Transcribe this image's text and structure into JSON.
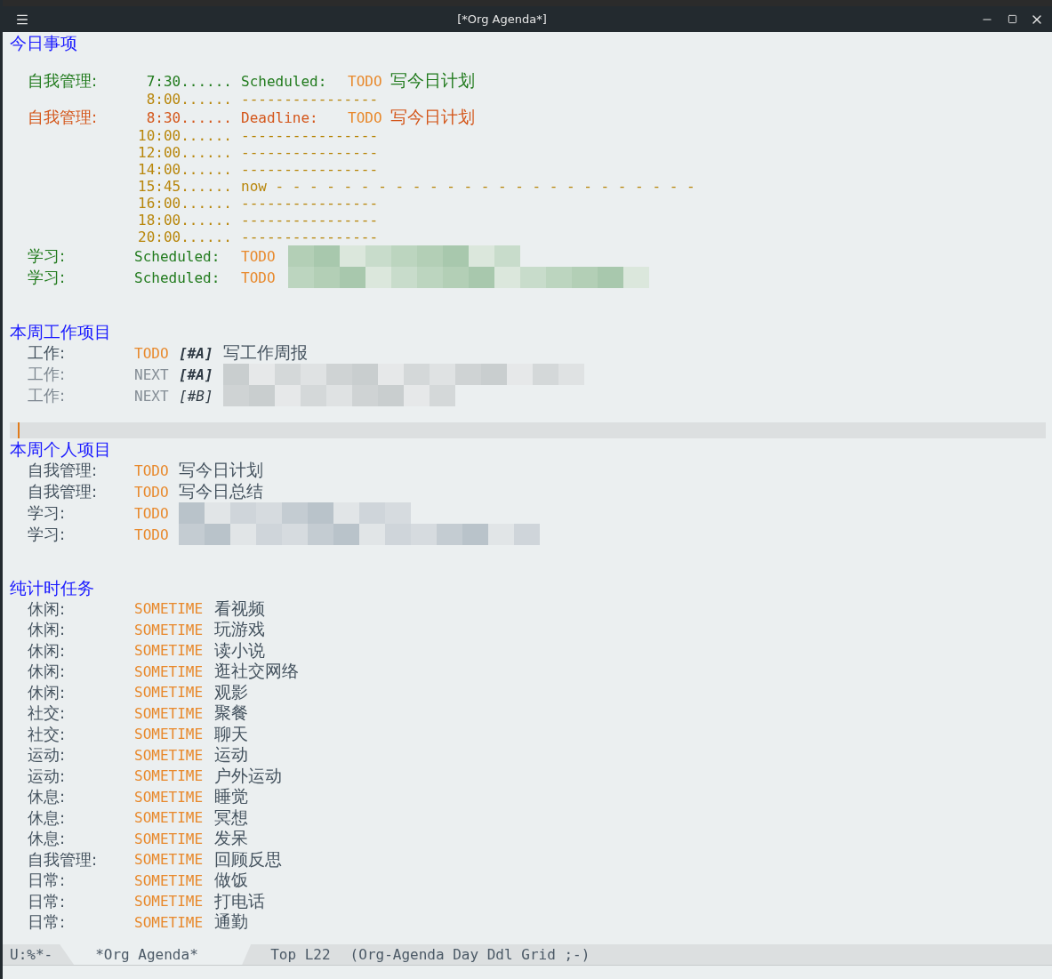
{
  "window": {
    "title": "[*Org Agenda*]"
  },
  "sections": [
    {
      "title": "今日事项",
      "kind": "day",
      "cursor_line": false,
      "items": [
        {
          "kind": "scheduled-timed",
          "category": "自我管理:",
          "time": "7:30......",
          "label": "Scheduled:",
          "keyword": "TODO",
          "text": "写今日计划"
        },
        {
          "kind": "grid",
          "time": "8:00......",
          "line": "----------------"
        },
        {
          "kind": "deadline-timed",
          "category": "自我管理:",
          "time": "8:30......",
          "label": "Deadline:",
          "keyword": "TODO",
          "text": "写今日计划"
        },
        {
          "kind": "grid",
          "time": "10:00......",
          "line": "----------------"
        },
        {
          "kind": "grid",
          "time": "12:00......",
          "line": "----------------"
        },
        {
          "kind": "grid",
          "time": "14:00......",
          "line": "----------------"
        },
        {
          "kind": "now",
          "time": "15:45......",
          "line": "now - - - - - - - - - - - - - - - - - - - - - - - - -"
        },
        {
          "kind": "grid",
          "time": "16:00......",
          "line": "----------------"
        },
        {
          "kind": "grid",
          "time": "18:00......",
          "line": "----------------"
        },
        {
          "kind": "grid",
          "time": "20:00......",
          "line": "----------------"
        },
        {
          "kind": "scheduled",
          "category": "学习:",
          "label": "Scheduled:",
          "keyword": "TODO",
          "redacted": true
        },
        {
          "kind": "scheduled",
          "category": "学习:",
          "label": "Scheduled:",
          "keyword": "TODO",
          "redacted": true
        }
      ]
    },
    {
      "title": "本周工作项目",
      "kind": "list",
      "cursor_line": true,
      "items": [
        {
          "kind": "todo",
          "category": "工作:",
          "keyword": "TODO",
          "priority": "[#A]",
          "priority_bold": true,
          "text": "写工作周报",
          "redacted": false
        },
        {
          "kind": "next",
          "category": "工作:",
          "keyword": "NEXT",
          "priority": "[#A]",
          "priority_bold": true,
          "redacted": true
        },
        {
          "kind": "next",
          "category": "工作:",
          "keyword": "NEXT",
          "priority": "[#B]",
          "priority_bold": false,
          "redacted": true
        }
      ]
    },
    {
      "title": "本周个人项目",
      "kind": "list",
      "cursor_line": false,
      "items": [
        {
          "kind": "todo",
          "category": "自我管理:",
          "keyword": "TODO",
          "text": "写今日计划",
          "redacted": false
        },
        {
          "kind": "todo",
          "category": "自我管理:",
          "keyword": "TODO",
          "text": "写今日总结",
          "redacted": false
        },
        {
          "kind": "todo",
          "category": "学习:",
          "keyword": "TODO",
          "redacted": true
        },
        {
          "kind": "todo",
          "category": "学习:",
          "keyword": "TODO",
          "redacted": true
        }
      ]
    },
    {
      "title": "纯计时任务",
      "kind": "list",
      "cursor_line": false,
      "items": [
        {
          "kind": "sometime",
          "category": "休闲:",
          "keyword": "SOMETIME",
          "text": "看视频",
          "redacted": false
        },
        {
          "kind": "sometime",
          "category": "休闲:",
          "keyword": "SOMETIME",
          "text": "玩游戏",
          "redacted": false
        },
        {
          "kind": "sometime",
          "category": "休闲:",
          "keyword": "SOMETIME",
          "text": "读小说",
          "redacted": false
        },
        {
          "kind": "sometime",
          "category": "休闲:",
          "keyword": "SOMETIME",
          "text": "逛社交网络",
          "redacted": false
        },
        {
          "kind": "sometime",
          "category": "休闲:",
          "keyword": "SOMETIME",
          "text": "观影",
          "redacted": false
        },
        {
          "kind": "sometime",
          "category": "社交:",
          "keyword": "SOMETIME",
          "text": "聚餐",
          "redacted": false
        },
        {
          "kind": "sometime",
          "category": "社交:",
          "keyword": "SOMETIME",
          "text": "聊天",
          "redacted": false
        },
        {
          "kind": "sometime",
          "category": "运动:",
          "keyword": "SOMETIME",
          "text": "运动",
          "redacted": false
        },
        {
          "kind": "sometime",
          "category": "运动:",
          "keyword": "SOMETIME",
          "text": "户外运动",
          "redacted": false
        },
        {
          "kind": "sometime",
          "category": "休息:",
          "keyword": "SOMETIME",
          "text": "睡觉",
          "redacted": false
        },
        {
          "kind": "sometime",
          "category": "休息:",
          "keyword": "SOMETIME",
          "text": "冥想",
          "redacted": false
        },
        {
          "kind": "sometime",
          "category": "休息:",
          "keyword": "SOMETIME",
          "text": "发呆",
          "redacted": false
        },
        {
          "kind": "sometime",
          "category": "自我管理:",
          "keyword": "SOMETIME",
          "text": "回顾反思",
          "redacted": false
        },
        {
          "kind": "sometime",
          "category": "日常:",
          "keyword": "SOMETIME",
          "text": "做饭",
          "redacted": false
        },
        {
          "kind": "sometime",
          "category": "日常:",
          "keyword": "SOMETIME",
          "text": "打电话",
          "redacted": false
        },
        {
          "kind": "sometime",
          "category": "日常:",
          "keyword": "SOMETIME",
          "text": "通勤",
          "redacted": false
        }
      ]
    }
  ],
  "mode_line": {
    "status": "U:%*-",
    "buffer": "*Org Agenda*",
    "position": "Top L22",
    "modes": "(Org-Agenda Day Ddl Grid ;-)"
  }
}
